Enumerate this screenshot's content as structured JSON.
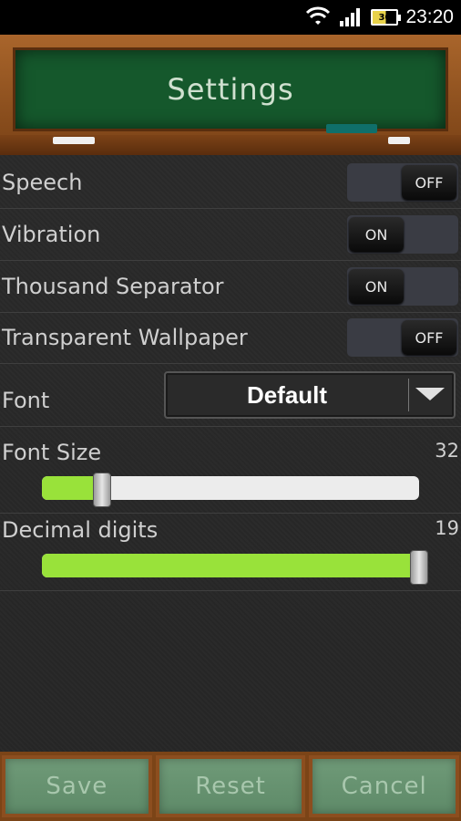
{
  "status_bar": {
    "time": "23:20",
    "battery_level": "30",
    "icons": [
      "wifi-icon",
      "signal-icon",
      "battery-icon"
    ]
  },
  "header": {
    "title": "Settings"
  },
  "settings": {
    "speech": {
      "label": "Speech",
      "state": "OFF"
    },
    "vibration": {
      "label": "Vibration",
      "state": "ON"
    },
    "thousand_separator": {
      "label": "Thousand Separator",
      "state": "ON"
    },
    "transparent_wallpaper": {
      "label": "Transparent Wallpaper",
      "state": "OFF"
    },
    "font": {
      "label": "Font",
      "value": "Default"
    },
    "font_size": {
      "label": "Font Size",
      "value": "32",
      "fill_fraction": 0.16
    },
    "decimal_digits": {
      "label": "Decimal digits",
      "value": "19",
      "fill_fraction": 1.0
    }
  },
  "buttons": {
    "save": "Save",
    "reset": "Reset",
    "cancel": "Cancel"
  },
  "colors": {
    "board": "#15582c",
    "frame": "#a9652b",
    "slider_fill": "#99e23a",
    "button": "#6f9a78"
  }
}
